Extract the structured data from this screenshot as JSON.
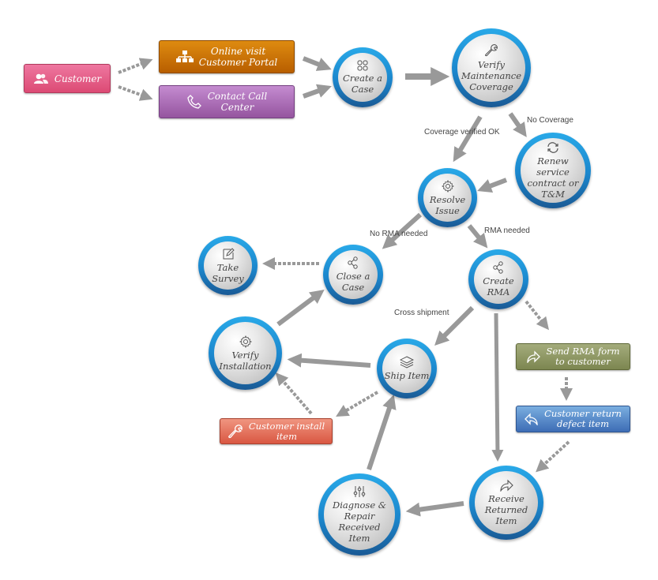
{
  "diagram": {
    "type": "process-flow",
    "title": "",
    "colors": {
      "customer": "#e2567f",
      "portal": "#d07a00",
      "call_center": "#a96ab5",
      "send_rma": "#8b9560",
      "return_defect": "#4a80c4",
      "install": "#e06a55",
      "circle_ring": "#1f8ed6",
      "arrow": "#999999"
    },
    "nodes": {
      "customer": {
        "label": "Customer",
        "icon": "users-icon"
      },
      "portal": {
        "label": "Online visit\nCustomer Portal",
        "icon": "sitemap-icon"
      },
      "call_center": {
        "label": "Contact Call\nCenter",
        "icon": "phone-icon"
      },
      "create_case": {
        "label": "Create a\nCase",
        "icon": "grid-icon"
      },
      "verify_coverage": {
        "label": "Verify\nMaintenance\nCoverage",
        "icon": "wrench-icon"
      },
      "renew": {
        "label": "Renew service\ncontract or\nT&M",
        "icon": "refresh-icon"
      },
      "resolve": {
        "label": "Resolve\nIssue",
        "icon": "gear-icon"
      },
      "close_case": {
        "label": "Close a\nCase",
        "icon": "share-icon"
      },
      "take_survey": {
        "label": "Take\nSurvey",
        "icon": "edit-icon"
      },
      "create_rma": {
        "label": "Create\nRMA",
        "icon": "share-icon"
      },
      "verify_install": {
        "label": "Verify\nInstallation",
        "icon": "gear-icon"
      },
      "ship_item": {
        "label": "Ship Item",
        "icon": "layers-icon"
      },
      "customer_install": {
        "label": "Customer install\nitem",
        "icon": "wrench-icon"
      },
      "send_rma": {
        "label": "Send RMA form\nto customer",
        "icon": "forward-icon"
      },
      "return_defect": {
        "label": "Customer return\ndefect item",
        "icon": "reply-icon"
      },
      "receive_returned": {
        "label": "Receive\nReturned\nItem",
        "icon": "forward-icon"
      },
      "diagnose": {
        "label": "Diagnose &\nRepair\nReceived\nItem",
        "icon": "sliders-icon"
      }
    },
    "edge_labels": {
      "coverage_ok": "Coverage verified OK",
      "no_coverage": "No Coverage",
      "no_rma": "No RMA needed",
      "rma_needed": "RMA needed",
      "cross_shipment": "Cross shipment"
    },
    "edges": [
      {
        "from": "customer",
        "to": "portal",
        "style": "dashed"
      },
      {
        "from": "customer",
        "to": "call_center",
        "style": "dashed"
      },
      {
        "from": "portal",
        "to": "create_case",
        "style": "solid"
      },
      {
        "from": "call_center",
        "to": "create_case",
        "style": "solid"
      },
      {
        "from": "create_case",
        "to": "verify_coverage",
        "style": "solid"
      },
      {
        "from": "verify_coverage",
        "to": "resolve",
        "style": "solid",
        "label": "Coverage verified OK"
      },
      {
        "from": "verify_coverage",
        "to": "renew",
        "style": "solid",
        "label": "No Coverage"
      },
      {
        "from": "renew",
        "to": "resolve",
        "style": "solid"
      },
      {
        "from": "resolve",
        "to": "close_case",
        "style": "solid",
        "label": "No RMA needed"
      },
      {
        "from": "resolve",
        "to": "create_rma",
        "style": "solid",
        "label": "RMA needed"
      },
      {
        "from": "close_case",
        "to": "take_survey",
        "style": "dashed"
      },
      {
        "from": "verify_install",
        "to": "close_case",
        "style": "solid"
      },
      {
        "from": "create_rma",
        "to": "ship_item",
        "style": "solid",
        "label": "Cross shipment"
      },
      {
        "from": "create_rma",
        "to": "send_rma",
        "style": "dashed"
      },
      {
        "from": "create_rma",
        "to": "receive_returned",
        "style": "solid"
      },
      {
        "from": "send_rma",
        "to": "return_defect",
        "style": "dashed"
      },
      {
        "from": "return_defect",
        "to": "receive_returned",
        "style": "dashed"
      },
      {
        "from": "receive_returned",
        "to": "diagnose",
        "style": "solid"
      },
      {
        "from": "diagnose",
        "to": "ship_item",
        "style": "solid"
      },
      {
        "from": "ship_item",
        "to": "verify_install",
        "style": "solid"
      },
      {
        "from": "ship_item",
        "to": "customer_install",
        "style": "dashed"
      },
      {
        "from": "customer_install",
        "to": "verify_install",
        "style": "dashed"
      }
    ]
  }
}
